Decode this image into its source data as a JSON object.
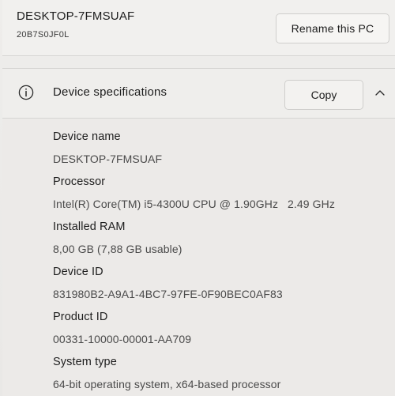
{
  "device": {
    "name": "DESKTOP-7FMSUAF",
    "model": "20B7S0JF0L",
    "rename_label": "Rename this PC"
  },
  "specs": {
    "title": "Device specifications",
    "copy_label": "Copy",
    "icon": "info-icon",
    "collapse_icon": "chevron-up-icon",
    "items": [
      {
        "label": "Device name",
        "value": "DESKTOP-7FMSUAF"
      },
      {
        "label": "Processor",
        "value": "Intel(R) Core(TM) i5-4300U CPU @ 1.90GHz   2.49 GHz"
      },
      {
        "label": "Installed RAM",
        "value": "8,00 GB (7,88 GB usable)"
      },
      {
        "label": "Device ID",
        "value": "831980B2-A9A1-4BC7-97FE-0F90BEC0AF83"
      },
      {
        "label": "Product ID",
        "value": "00331-10000-00001-AA709"
      },
      {
        "label": "System type",
        "value": "64-bit operating system, x64-based processor"
      }
    ]
  }
}
